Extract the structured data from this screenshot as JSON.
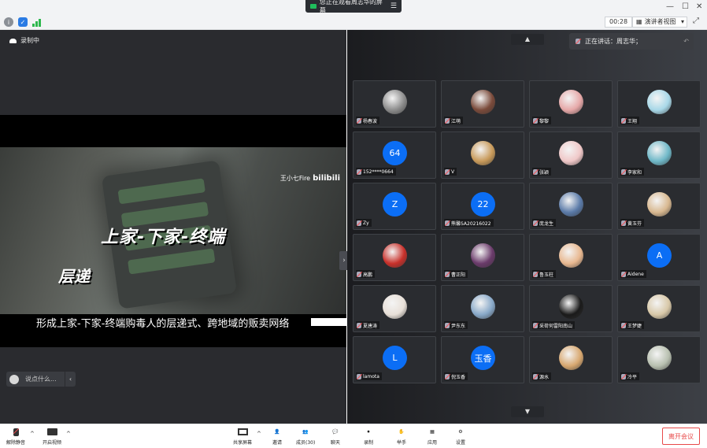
{
  "topbar": {
    "sharing_notice": "您正在观看周志华的屏幕",
    "timer": "00:28",
    "view_mode": "演讲者视图"
  },
  "share": {
    "recording": "录制中",
    "watermark": "王小七Fire",
    "watermark_brand": "bilibili",
    "title_line1": "上家-下家-终端",
    "title_line2": "层递",
    "subtitle": "形成上家-下家-终端购毒人的层递式、跨地域的贩卖网络",
    "chat_placeholder": "说点什么..."
  },
  "gallery": {
    "speaking": "正在讲话：周志华；",
    "participants": [
      {
        "name": "杨春波",
        "avatar": "photo",
        "color": "#8c8c8c"
      },
      {
        "name": "江萌",
        "avatar": "photo",
        "color": "#7a4a3a"
      },
      {
        "name": "黎黎",
        "avatar": "photo",
        "color": "#e6a8a8"
      },
      {
        "name": "王翔",
        "avatar": "photo",
        "color": "#a8d8e8"
      },
      {
        "name": "152****0664",
        "avatar": "letter",
        "letter": "64"
      },
      {
        "name": "V",
        "avatar": "photo",
        "color": "#c89a5a"
      },
      {
        "name": "张颖",
        "avatar": "photo",
        "color": "#f0c8c8"
      },
      {
        "name": "李家和",
        "avatar": "photo",
        "color": "#6fb8c8"
      },
      {
        "name": "Zy",
        "avatar": "letter",
        "letter": "Z"
      },
      {
        "name": "熊馨SA20216022",
        "avatar": "letter",
        "letter": "22"
      },
      {
        "name": "庞龙生",
        "avatar": "photo",
        "color": "#5a7aa8"
      },
      {
        "name": "黄玉芬",
        "avatar": "photo",
        "color": "#d8b890"
      },
      {
        "name": "高鹏",
        "avatar": "photo",
        "color": "#c8302a"
      },
      {
        "name": "曹正阳",
        "avatar": "photo",
        "color": "#6a3a6a"
      },
      {
        "name": "鲁玉柱",
        "avatar": "photo",
        "color": "#e8b890"
      },
      {
        "name": "Aidene",
        "avatar": "letter",
        "letter": "A"
      },
      {
        "name": "夏唐涛",
        "avatar": "photo",
        "color": "#e8e0d8"
      },
      {
        "name": "尹东东",
        "avatar": "photo",
        "color": "#88a8c8"
      },
      {
        "name": "采荷何雷阳南山",
        "avatar": "photo",
        "color": "#1a1a1a"
      },
      {
        "name": "王梦婕",
        "avatar": "photo",
        "color": "#d8c8a8"
      },
      {
        "name": "lamota",
        "avatar": "letter",
        "letter": "L"
      },
      {
        "name": "倪玉香",
        "avatar": "letter",
        "letter": "玉香"
      },
      {
        "name": "源水",
        "avatar": "photo",
        "color": "#d8a870"
      },
      {
        "name": "冷平",
        "avatar": "photo",
        "color": "#b8c0b0"
      }
    ]
  },
  "toolbar": {
    "unmute": "解除静音",
    "start_video": "开启视频",
    "share_screen": "共享屏幕",
    "invite": "邀请",
    "members": "成员(30)",
    "chat": "聊天",
    "record": "录制",
    "raise_hand": "举手",
    "apps": "应用",
    "settings": "设置",
    "leave": "离开会议"
  }
}
